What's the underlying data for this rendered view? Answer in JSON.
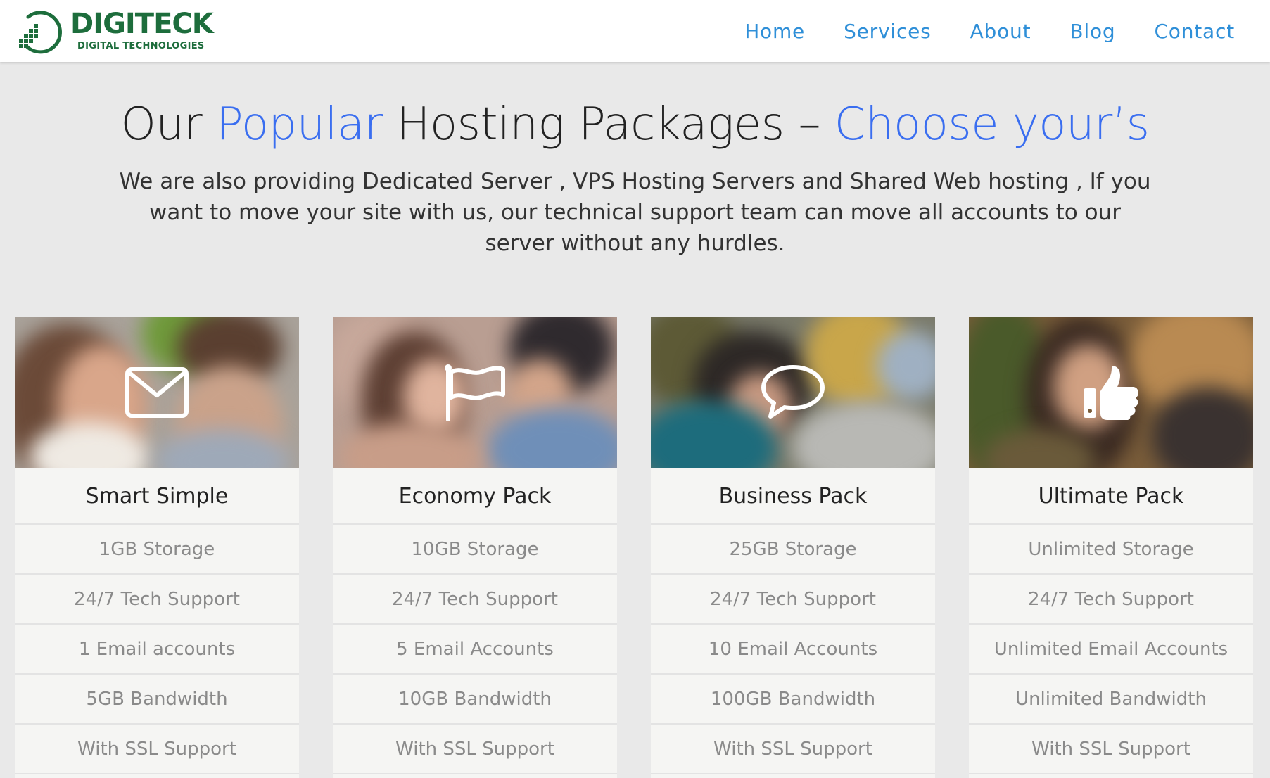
{
  "brand": {
    "name": "DIGITECK",
    "tagline": "DIGITAL TECHNOLOGIES",
    "color": "#1d6d3c"
  },
  "nav": {
    "items": [
      {
        "label": "Home"
      },
      {
        "label": "Services"
      },
      {
        "label": "About"
      },
      {
        "label": "Blog"
      },
      {
        "label": "Contact"
      }
    ],
    "color": "#2f8fd8"
  },
  "section": {
    "title_part1": "Our ",
    "title_accent1": "Popular",
    "title_part2": " Hosting Packages – ",
    "title_accent2": "Choose your’s",
    "accent_color": "#3a6ef0",
    "description": "We are also providing Dedicated Server , VPS Hosting Servers and Shared Web hosting , If you want to move your site with us, our technical support team can move all accounts to our server without any hurdles."
  },
  "packages": [
    {
      "title": "Smart Simple",
      "icon": "envelope-icon",
      "features": [
        "1GB Storage",
        "24/7 Tech Support",
        "1 Email accounts",
        "5GB Bandwidth",
        "With SSL Support"
      ]
    },
    {
      "title": "Economy Pack",
      "icon": "flag-icon",
      "features": [
        "10GB Storage",
        "24/7 Tech Support",
        "5 Email Accounts",
        "10GB Bandwidth",
        "With SSL Support"
      ]
    },
    {
      "title": "Business Pack",
      "icon": "speech-bubble-icon",
      "features": [
        "25GB Storage",
        "24/7 Tech Support",
        "10 Email Accounts",
        "100GB Bandwidth",
        "With SSL Support"
      ]
    },
    {
      "title": "Ultimate Pack",
      "icon": "thumbs-up-icon",
      "features": [
        "Unlimited Storage",
        "24/7 Tech Support",
        "Unlimited Email Accounts",
        "Unlimited Bandwidth",
        "With SSL Support"
      ]
    }
  ]
}
